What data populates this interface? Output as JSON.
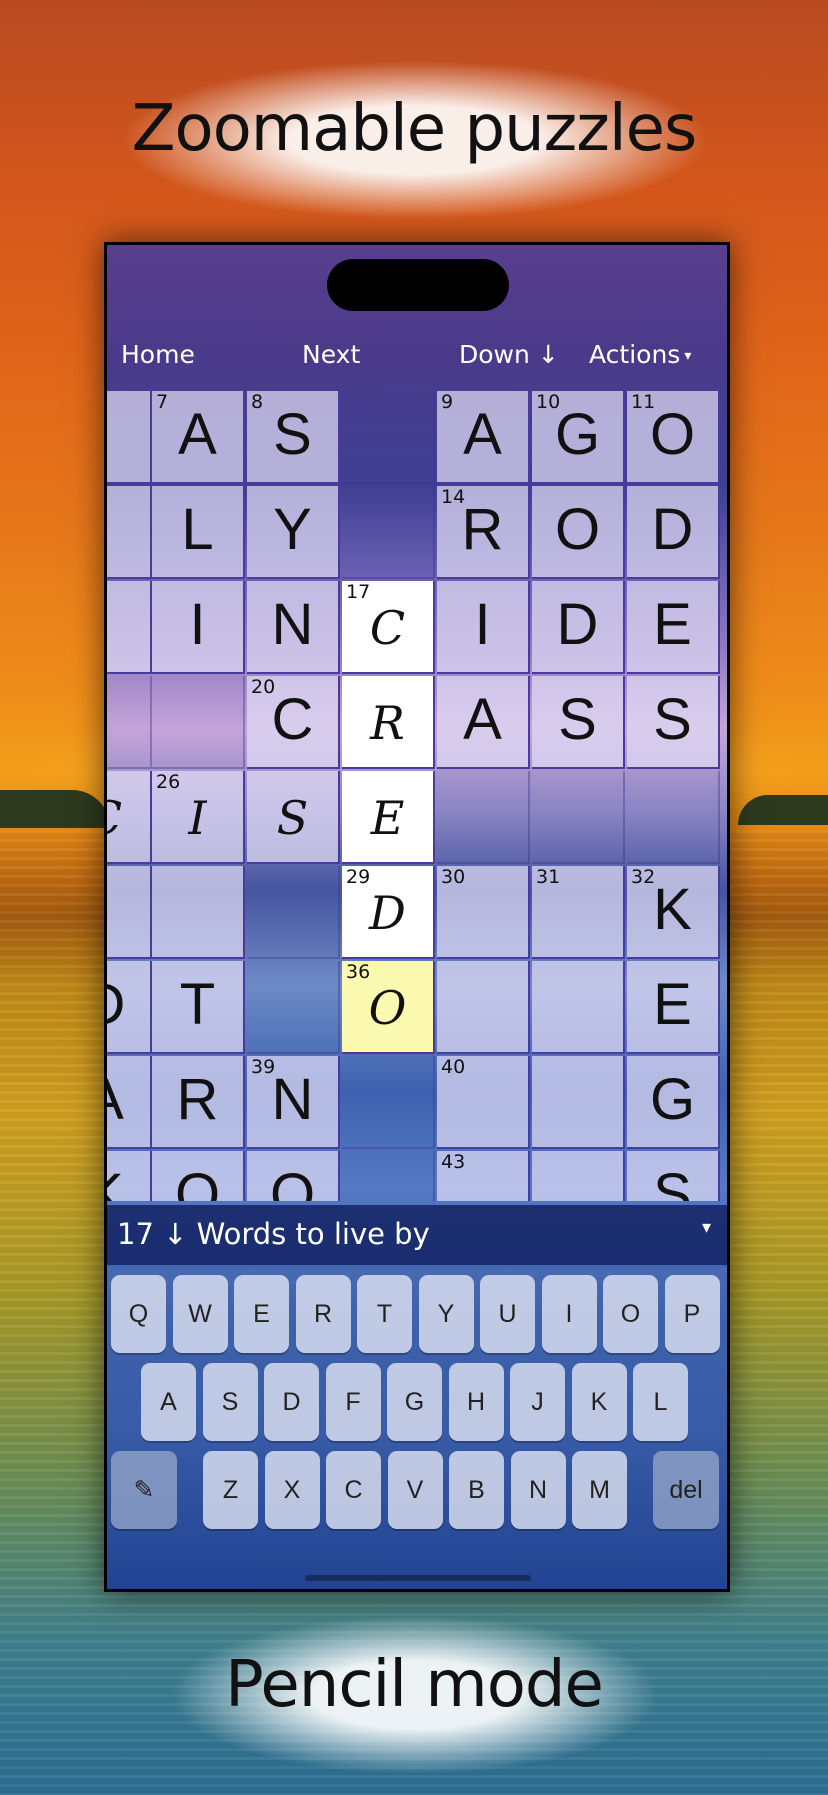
{
  "promo": {
    "headline_top": "Zoomable puzzles",
    "headline_bottom": "Pencil mode"
  },
  "nav": {
    "home": "Home",
    "next": "Next",
    "down": "Down ↓",
    "actions": "Actions",
    "actions_caret": "▾"
  },
  "grid": {
    "rows": [
      [
        {
          "t": "w",
          "n": "",
          "l": ""
        },
        {
          "t": "w",
          "n": "7",
          "l": "A"
        },
        {
          "t": "w",
          "n": "8",
          "l": "S"
        },
        {
          "t": "b"
        },
        {
          "t": "w",
          "n": "9",
          "l": "A"
        },
        {
          "t": "w",
          "n": "10",
          "l": "G"
        },
        {
          "t": "w",
          "n": "11",
          "l": "O"
        }
      ],
      [
        {
          "t": "w",
          "n": "",
          "l": ""
        },
        {
          "t": "w",
          "n": "",
          "l": "L"
        },
        {
          "t": "w",
          "n": "",
          "l": "Y"
        },
        {
          "t": "b"
        },
        {
          "t": "w",
          "n": "14",
          "l": "R"
        },
        {
          "t": "w",
          "n": "",
          "l": "O"
        },
        {
          "t": "w",
          "n": "",
          "l": "D"
        }
      ],
      [
        {
          "t": "w",
          "n": "",
          "l": ""
        },
        {
          "t": "w",
          "n": "",
          "l": "I"
        },
        {
          "t": "w",
          "n": "",
          "l": "N"
        },
        {
          "t": "h",
          "n": "17",
          "l": "C",
          "p": true
        },
        {
          "t": "w",
          "n": "",
          "l": "I"
        },
        {
          "t": "w",
          "n": "",
          "l": "D"
        },
        {
          "t": "w",
          "n": "",
          "l": "E"
        }
      ],
      [
        {
          "t": "b"
        },
        {
          "t": "b"
        },
        {
          "t": "w",
          "n": "20",
          "l": "C"
        },
        {
          "t": "h",
          "n": "",
          "l": "R",
          "p": true
        },
        {
          "t": "w",
          "n": "",
          "l": "A"
        },
        {
          "t": "w",
          "n": "",
          "l": "S"
        },
        {
          "t": "w",
          "n": "",
          "l": "S"
        }
      ],
      [
        {
          "t": "w",
          "n": "",
          "l": "C",
          "p": true
        },
        {
          "t": "w",
          "n": "26",
          "l": "I",
          "p": true
        },
        {
          "t": "w",
          "n": "",
          "l": "S",
          "p": true
        },
        {
          "t": "h",
          "n": "",
          "l": "E",
          "p": true
        },
        {
          "t": "b"
        },
        {
          "t": "b"
        },
        {
          "t": "b"
        }
      ],
      [
        {
          "t": "w",
          "n": "",
          "l": ""
        },
        {
          "t": "w",
          "n": "",
          "l": ""
        },
        {
          "t": "b"
        },
        {
          "t": "h",
          "n": "29",
          "l": "D",
          "p": true
        },
        {
          "t": "w",
          "n": "30",
          "l": ""
        },
        {
          "t": "w",
          "n": "31",
          "l": ""
        },
        {
          "t": "w",
          "n": "32",
          "l": "K"
        }
      ],
      [
        {
          "t": "w",
          "n": "",
          "l": "D"
        },
        {
          "t": "w",
          "n": "",
          "l": "T"
        },
        {
          "t": "b"
        },
        {
          "t": "c",
          "n": "36",
          "l": "O",
          "p": true
        },
        {
          "t": "w",
          "n": "",
          "l": ""
        },
        {
          "t": "w",
          "n": "",
          "l": ""
        },
        {
          "t": "w",
          "n": "",
          "l": "E"
        }
      ],
      [
        {
          "t": "w",
          "n": "",
          "l": "A"
        },
        {
          "t": "w",
          "n": "",
          "l": "R"
        },
        {
          "t": "w",
          "n": "39",
          "l": "N"
        },
        {
          "t": "b"
        },
        {
          "t": "w",
          "n": "40",
          "l": ""
        },
        {
          "t": "w",
          "n": "",
          "l": ""
        },
        {
          "t": "w",
          "n": "",
          "l": "G"
        }
      ],
      [
        {
          "t": "w",
          "n": "",
          "l": "K"
        },
        {
          "t": "w",
          "n": "",
          "l": "O"
        },
        {
          "t": "w",
          "n": "",
          "l": "O"
        },
        {
          "t": "b"
        },
        {
          "t": "w",
          "n": "43",
          "l": ""
        },
        {
          "t": "w",
          "n": "",
          "l": ""
        },
        {
          "t": "w",
          "n": "",
          "l": "S"
        }
      ]
    ]
  },
  "clue": {
    "text": "17 ↓ Words to live by",
    "dropdown": "▾"
  },
  "keyboard": {
    "row1": [
      "Q",
      "W",
      "E",
      "R",
      "T",
      "Y",
      "U",
      "I",
      "O",
      "P"
    ],
    "row2": [
      "A",
      "S",
      "D",
      "F",
      "G",
      "H",
      "J",
      "K",
      "L"
    ],
    "row3": [
      "Z",
      "X",
      "C",
      "V",
      "B",
      "N",
      "M"
    ],
    "pencil": "✎",
    "del": "del"
  }
}
